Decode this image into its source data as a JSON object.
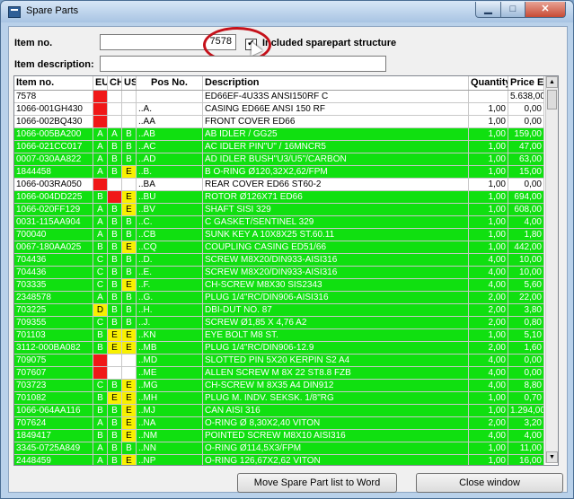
{
  "window": {
    "title": "Spare Parts"
  },
  "form": {
    "item_no_label": "Item no.",
    "item_no_value": "7578",
    "included_label": "Included sparepart structure",
    "included_checked": true,
    "item_desc_label": "Item description:",
    "item_desc_value": ""
  },
  "table": {
    "headers": [
      "Item no.",
      "EU",
      "CH",
      "US",
      "Pos No.",
      "Description",
      "Quantity",
      "Price EUR"
    ],
    "rows": [
      {
        "item": "7578",
        "eu": "",
        "ch": "",
        "us": "",
        "pos": "",
        "desc": "ED66EF-4U33S ANSI150RF C",
        "qty": "",
        "price": "5.638,00",
        "color": "w",
        "flags": [
          "red",
          "",
          ""
        ]
      },
      {
        "item": "1066-001GH430",
        "eu": "",
        "ch": "",
        "us": "",
        "pos": "..A.",
        "desc": "CASING ED66E ANSI 150 RF",
        "qty": "1,00",
        "price": "0,00",
        "color": "w",
        "flags": [
          "red",
          "",
          ""
        ]
      },
      {
        "item": "1066-002BQ430",
        "eu": "",
        "ch": "",
        "us": "",
        "pos": "..AA",
        "desc": "FRONT COVER ED66",
        "qty": "1,00",
        "price": "0,00",
        "color": "w",
        "flags": [
          "red",
          "",
          ""
        ]
      },
      {
        "item": "1066-005BA200",
        "eu": "A",
        "ch": "A",
        "us": "B",
        "pos": "..AB",
        "desc": "AB IDLER / GG25",
        "qty": "1,00",
        "price": "159,00",
        "color": "g",
        "flags": [
          "",
          "",
          ""
        ]
      },
      {
        "item": "1066-021CC017",
        "eu": "A",
        "ch": "B",
        "us": "B",
        "pos": "..AC",
        "desc": "AC IDLER PIN\"U\" / 16MNCR5",
        "qty": "1,00",
        "price": "47,00",
        "color": "g",
        "flags": [
          "",
          "",
          ""
        ]
      },
      {
        "item": "0007-030AA822",
        "eu": "A",
        "ch": "B",
        "us": "B",
        "pos": "..AD",
        "desc": "AD IDLER BUSH\"U3/U5\"/CARBON",
        "qty": "1,00",
        "price": "63,00",
        "color": "g",
        "flags": [
          "",
          "",
          ""
        ]
      },
      {
        "item": "1844458",
        "eu": "A",
        "ch": "B",
        "us": "E",
        "pos": "..B.",
        "desc": "B O-RING Ø120,32X2,62/FPM",
        "qty": "1,00",
        "price": "15,00",
        "color": "g",
        "flags": [
          "",
          "",
          "yel"
        ]
      },
      {
        "item": "1066-003RA050",
        "eu": "",
        "ch": "",
        "us": "",
        "pos": "..BA",
        "desc": "REAR COVER ED66 ST60-2",
        "qty": "1,00",
        "price": "0,00",
        "color": "w",
        "flags": [
          "red",
          "",
          ""
        ]
      },
      {
        "item": "1066-004DD225",
        "eu": "B",
        "ch": "",
        "us": "E",
        "pos": "..BU",
        "desc": "ROTOR Ø126X71 ED66",
        "qty": "1,00",
        "price": "694,00",
        "color": "g",
        "flags": [
          "",
          "red",
          "yel"
        ]
      },
      {
        "item": "1066-020FF129",
        "eu": "A",
        "ch": "B",
        "us": "E",
        "pos": "..BV",
        "desc": "SHAFT SISI 329",
        "qty": "1,00",
        "price": "608,00",
        "color": "g",
        "flags": [
          "",
          "",
          "yel"
        ]
      },
      {
        "item": "0031-115AA904",
        "eu": "A",
        "ch": "B",
        "us": "B",
        "pos": "..C.",
        "desc": "C GASKET/SENTINEL 329",
        "qty": "1,00",
        "price": "4,00",
        "color": "g",
        "flags": [
          "",
          "",
          ""
        ]
      },
      {
        "item": "700040",
        "eu": "A",
        "ch": "B",
        "us": "B",
        "pos": "..CB",
        "desc": "SUNK KEY A 10X8X25 ST.60.11",
        "qty": "1,00",
        "price": "1,80",
        "color": "g",
        "flags": [
          "",
          "",
          ""
        ]
      },
      {
        "item": "0067-180AA025",
        "eu": "B",
        "ch": "B",
        "us": "E",
        "pos": "..CQ",
        "desc": "COUPLING CASING ED51/66",
        "qty": "1,00",
        "price": "442,00",
        "color": "g",
        "flags": [
          "",
          "",
          "yel"
        ]
      },
      {
        "item": "704436",
        "eu": "C",
        "ch": "B",
        "us": "B",
        "pos": "..D.",
        "desc": "SCREW M8X20/DIN933-AISI316",
        "qty": "4,00",
        "price": "10,00",
        "color": "g",
        "flags": [
          "",
          "",
          ""
        ]
      },
      {
        "item": "704436",
        "eu": "C",
        "ch": "B",
        "us": "B",
        "pos": "..E.",
        "desc": "SCREW M8X20/DIN933-AISI316",
        "qty": "4,00",
        "price": "10,00",
        "color": "g",
        "flags": [
          "",
          "",
          ""
        ]
      },
      {
        "item": "703335",
        "eu": "C",
        "ch": "B",
        "us": "E",
        "pos": "..F.",
        "desc": "CH-SCREW M8X30 SIS2343",
        "qty": "4,00",
        "price": "5,60",
        "color": "g",
        "flags": [
          "",
          "",
          "yel"
        ]
      },
      {
        "item": "2348578",
        "eu": "A",
        "ch": "B",
        "us": "B",
        "pos": "..G.",
        "desc": "PLUG 1/4\"RC/DIN906-AISI316",
        "qty": "2,00",
        "price": "22,00",
        "color": "g",
        "flags": [
          "",
          "",
          ""
        ]
      },
      {
        "item": "703225",
        "eu": "D",
        "ch": "B",
        "us": "B",
        "pos": "..H.",
        "desc": "DBI-DUT NO. 87",
        "qty": "2,00",
        "price": "3,80",
        "color": "g",
        "flags": [
          "yel",
          "",
          ""
        ]
      },
      {
        "item": "709355",
        "eu": "C",
        "ch": "B",
        "us": "B",
        "pos": "..J.",
        "desc": "SCREW Ø1,85 X 4,76 A2",
        "qty": "2,00",
        "price": "0,80",
        "color": "g",
        "flags": [
          "",
          "",
          ""
        ]
      },
      {
        "item": "701103",
        "eu": "B",
        "ch": "E",
        "us": "E",
        "pos": "..KN",
        "desc": "EYE BOLT M8 ST.",
        "qty": "1,00",
        "price": "5,10",
        "color": "g",
        "flags": [
          "",
          "yel",
          "yel"
        ]
      },
      {
        "item": "3112-000BA082",
        "eu": "B",
        "ch": "E",
        "us": "E",
        "pos": "..MB",
        "desc": "PLUG 1/4\"RC/DIN906-12.9",
        "qty": "2,00",
        "price": "1,60",
        "color": "g",
        "flags": [
          "",
          "yel",
          "yel"
        ]
      },
      {
        "item": "709075",
        "eu": "",
        "ch": "",
        "us": "",
        "pos": "..MD",
        "desc": "SLOTTED PIN 5X20 KERPIN S2 A4",
        "qty": "4,00",
        "price": "0,00",
        "color": "g",
        "flags": [
          "red",
          "emp",
          "emp"
        ]
      },
      {
        "item": "707607",
        "eu": "",
        "ch": "",
        "us": "",
        "pos": "..ME",
        "desc": "ALLEN SCREW M 8X 22 ST8.8 FZB",
        "qty": "4,00",
        "price": "0,00",
        "color": "g",
        "flags": [
          "red",
          "emp",
          "emp"
        ]
      },
      {
        "item": "703723",
        "eu": "C",
        "ch": "B",
        "us": "E",
        "pos": "..MG",
        "desc": "CH-SCREW M 8X35 A4 DIN912",
        "qty": "4,00",
        "price": "8,80",
        "color": "g",
        "flags": [
          "",
          "",
          "yel"
        ]
      },
      {
        "item": "701082",
        "eu": "B",
        "ch": "E",
        "us": "E",
        "pos": "..MH",
        "desc": "PLUG M. INDV. SEKSK. 1/8\"RG",
        "qty": "1,00",
        "price": "0,70",
        "color": "g",
        "flags": [
          "",
          "yel",
          "yel"
        ]
      },
      {
        "item": "1066-064AA116",
        "eu": "B",
        "ch": "B",
        "us": "E",
        "pos": "..MJ",
        "desc": "CAN AISI 316",
        "qty": "1,00",
        "price": "1.294,00",
        "color": "g",
        "flags": [
          "",
          "",
          "yel"
        ]
      },
      {
        "item": "707624",
        "eu": "A",
        "ch": "B",
        "us": "E",
        "pos": "..NA",
        "desc": "O-RING Ø 8,30X2,40 VITON",
        "qty": "2,00",
        "price": "3,20",
        "color": "g",
        "flags": [
          "",
          "",
          "yel"
        ]
      },
      {
        "item": "1849417",
        "eu": "B",
        "ch": "B",
        "us": "E",
        "pos": "..NM",
        "desc": "POINTED SCREW M8X10 AISI316",
        "qty": "4,00",
        "price": "4,00",
        "color": "g",
        "flags": [
          "",
          "",
          "yel"
        ]
      },
      {
        "item": "3345-0725A849",
        "eu": "A",
        "ch": "B",
        "us": "B",
        "pos": "..NN",
        "desc": "O-RING Ø114,5X3/FPM",
        "qty": "1,00",
        "price": "11,00",
        "color": "g",
        "flags": [
          "",
          "",
          ""
        ]
      },
      {
        "item": "2448459",
        "eu": "A",
        "ch": "B",
        "us": "E",
        "pos": "..NP",
        "desc": "O-RING 126,67X2,62 VITON",
        "qty": "1,00",
        "price": "16,00",
        "color": "g",
        "flags": [
          "",
          "",
          "yel"
        ]
      }
    ]
  },
  "buttons": {
    "move_label": "Move Spare Part list to Word",
    "close_label": "Close window"
  },
  "colors": {
    "available": "#10e010",
    "missing": "#f01818",
    "warning": "#f8f000"
  }
}
